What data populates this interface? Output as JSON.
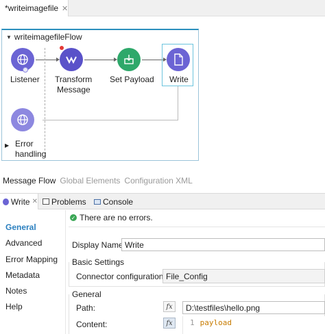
{
  "editor_tab": {
    "icon": "mule-logo-icon",
    "label": "*writeimagefile",
    "close": "✕"
  },
  "flow": {
    "title": "writeimagefileFlow",
    "nodes": {
      "listener": "Listener",
      "transform": [
        "Transform",
        "Message"
      ],
      "set_payload": "Set Payload",
      "write": "Write",
      "error": [
        "Error",
        "handling"
      ]
    }
  },
  "message_flow_tabs": [
    "Message Flow",
    "Global Elements",
    "Configuration XML"
  ],
  "panel_tabs": {
    "write": "Write",
    "problems": "Problems",
    "console": "Console",
    "close": "✕"
  },
  "side_nav": [
    "General",
    "Advanced",
    "Error Mapping",
    "Metadata",
    "Notes",
    "Help"
  ],
  "status": "There are no errors.",
  "display_name": {
    "label": "Display Name:",
    "value": "Write"
  },
  "basic_settings": {
    "title": "Basic Settings",
    "connector_label": "Connector configuration:",
    "connector_value": "File_Config"
  },
  "general": {
    "title": "General",
    "path_label": "Path:",
    "path_value": "D:\\testfiles\\hello.png",
    "content_label": "Content:",
    "fx": "fx",
    "code": {
      "line": "1",
      "text": "payload"
    }
  },
  "colors": {
    "accent": "#2a8fbd",
    "selected_nav": "#2a7fbf",
    "ok": "#3aa655"
  }
}
